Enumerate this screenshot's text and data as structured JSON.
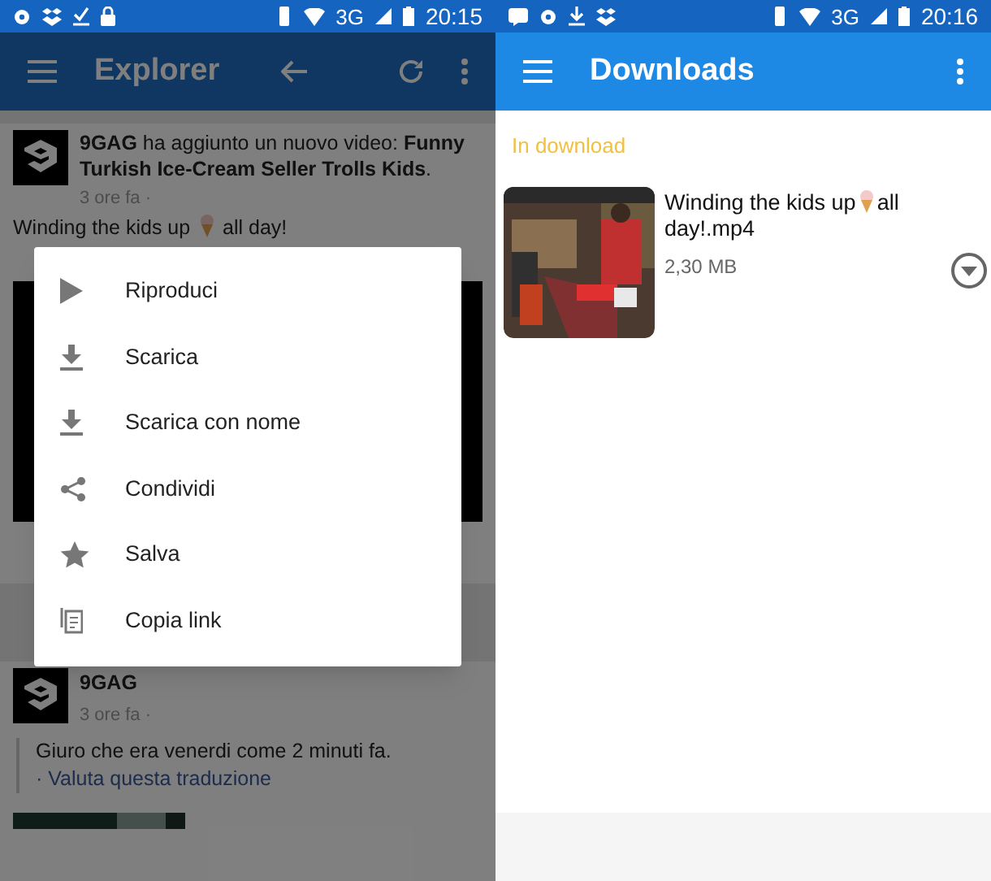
{
  "left_screen": {
    "status_bar": {
      "network": "3G",
      "time": "20:15"
    },
    "app_bar": {
      "title": "Explorer"
    },
    "posts": [
      {
        "headline": "**9GAG** ha aggiunto un nuovo video: **Funny Turkish Ice-Cream Seller Trolls Kids**.",
        "time": "3 ore fa ·",
        "caption": [
          "Winding the kids up",
          "all day!"
        ]
      },
      {
        "author": "9GAG",
        "time": "3 ore fa ·",
        "body": "Giuro che era venerdi come 2 minuti fa.",
        "link": "· Valuta questa traduzione"
      }
    ],
    "context_menu": [
      "Riproduci",
      "Scarica",
      "Scarica con nome",
      "Condividi",
      "Salva",
      "Copia link"
    ]
  },
  "right_screen": {
    "status_bar": {
      "network": "3G",
      "time": "20:16"
    },
    "app_bar": {
      "title": "Downloads"
    },
    "section": "In download",
    "downloads": [
      {
        "title": [
          "Winding the kids up",
          "all",
          "day!.mp4"
        ],
        "size": "2,30 MB"
      }
    ]
  }
}
